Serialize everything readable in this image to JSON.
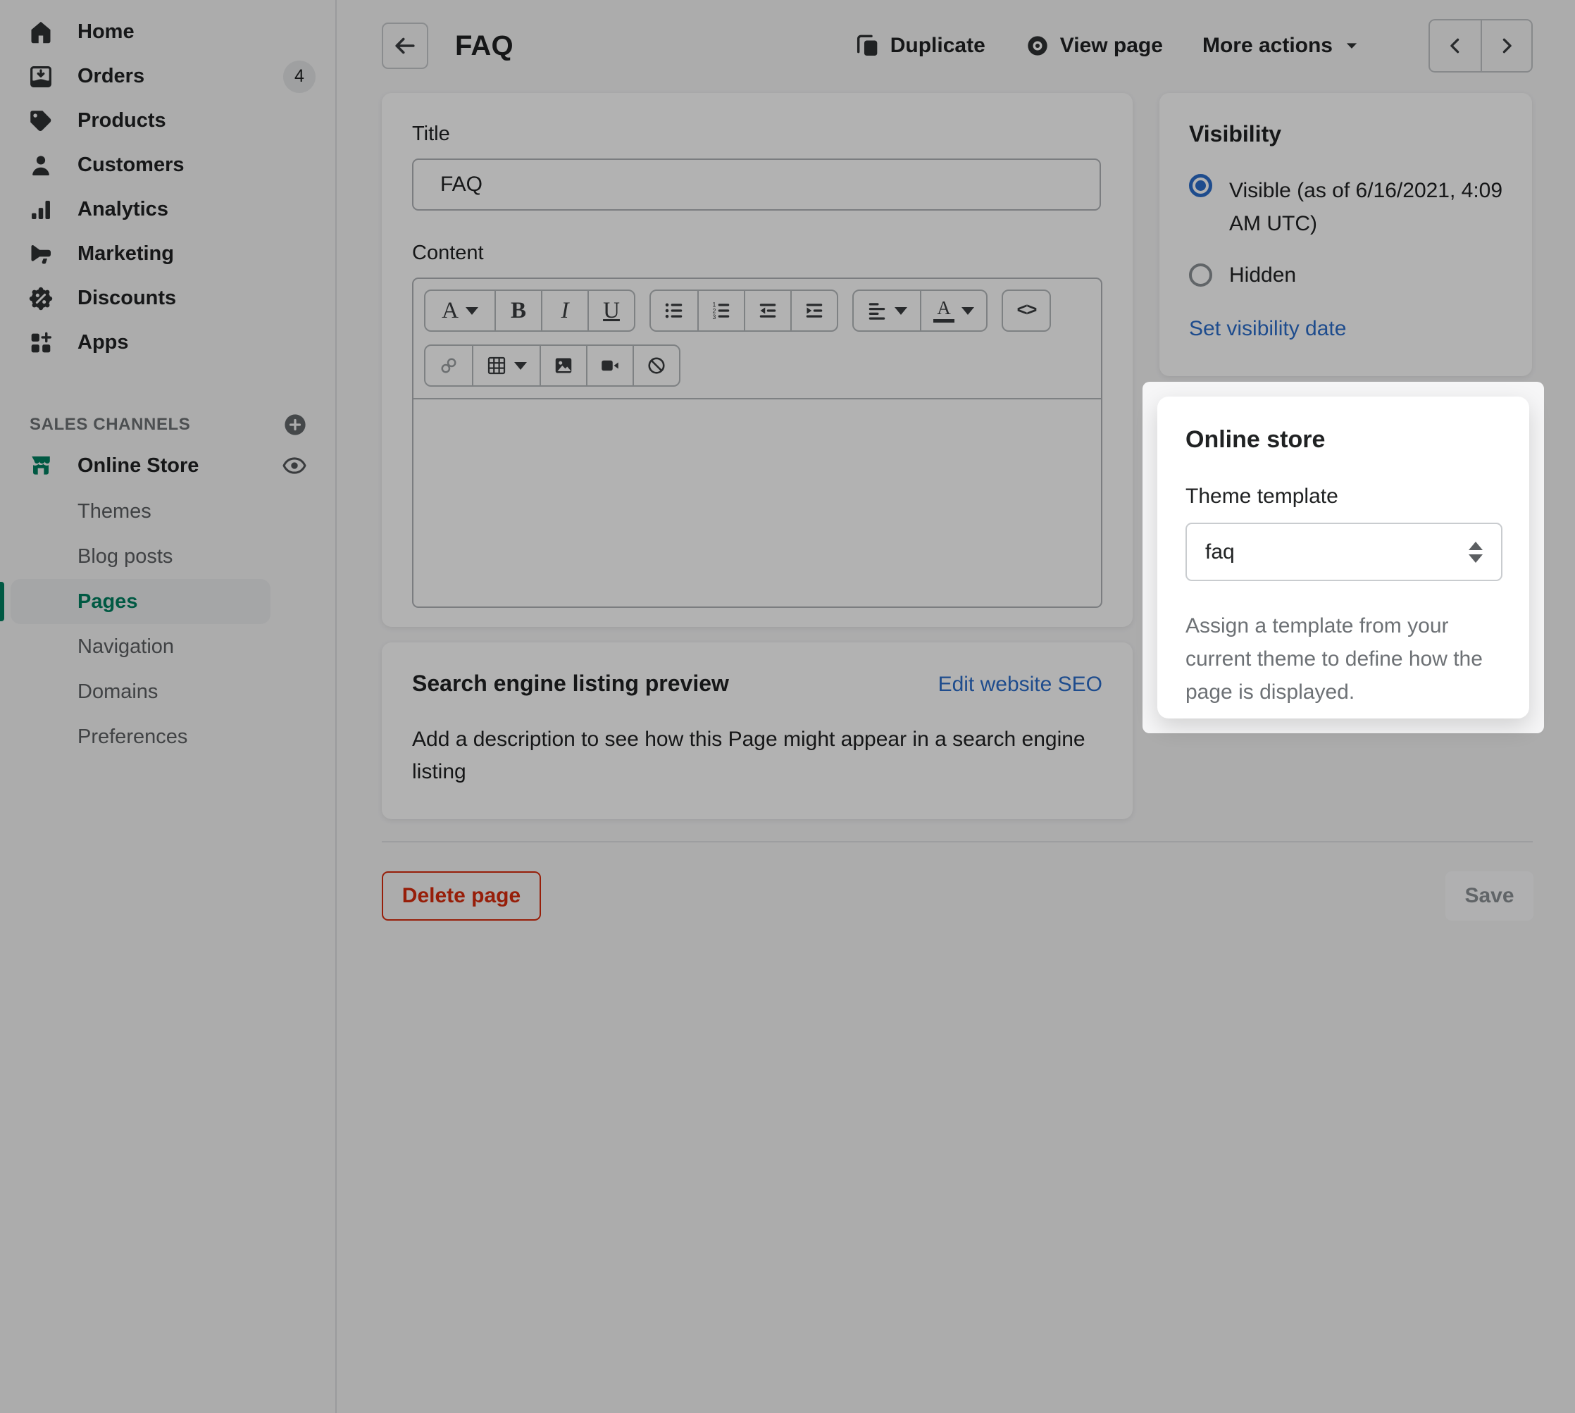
{
  "sidebar": {
    "items": [
      {
        "label": "Home",
        "icon": "home-icon"
      },
      {
        "label": "Orders",
        "icon": "orders-icon",
        "badge": "4"
      },
      {
        "label": "Products",
        "icon": "tag-icon"
      },
      {
        "label": "Customers",
        "icon": "person-icon"
      },
      {
        "label": "Analytics",
        "icon": "bar-chart-icon"
      },
      {
        "label": "Marketing",
        "icon": "megaphone-icon"
      },
      {
        "label": "Discounts",
        "icon": "discount-badge-icon"
      },
      {
        "label": "Apps",
        "icon": "apps-grid-icon"
      }
    ],
    "sales_channels": {
      "heading": "SALES CHANNELS",
      "add_icon": "plus-circle-icon",
      "store_label": "Online Store",
      "store_icon": "storefront-icon",
      "preview_icon": "eye-icon",
      "subitems": [
        {
          "label": "Themes"
        },
        {
          "label": "Blog posts"
        },
        {
          "label": "Pages",
          "active": true
        },
        {
          "label": "Navigation"
        },
        {
          "label": "Domains"
        },
        {
          "label": "Preferences"
        }
      ]
    }
  },
  "header": {
    "title": "FAQ",
    "duplicate_label": "Duplicate",
    "view_page_label": "View page",
    "more_actions_label": "More actions"
  },
  "title_card": {
    "title_label": "Title",
    "title_value": "FAQ",
    "content_label": "Content"
  },
  "toolbar": {
    "font_glyph": "A",
    "bold_glyph": "B",
    "italic_glyph": "I",
    "underline_glyph": "U",
    "color_glyph": "A",
    "code_glyph": "<>",
    "ordered_digits": [
      "1",
      "2",
      "3"
    ],
    "icons": [
      "formatting-icon",
      "bold-icon",
      "italic-icon",
      "underline-icon",
      "bulleted-list-icon",
      "numbered-list-icon",
      "outdent-icon",
      "indent-icon",
      "alignment-icon",
      "text-color-icon",
      "code-icon",
      "link-icon",
      "table-icon",
      "image-icon",
      "video-icon",
      "clear-formatting-icon"
    ]
  },
  "seo_card": {
    "title": "Search engine listing preview",
    "action_label": "Edit website SEO",
    "body": "Add a description to see how this Page might appear in a search engine listing"
  },
  "visibility_card": {
    "title": "Visibility",
    "options": [
      {
        "label": "Visible (as of 6/16/2021, 4:09 AM UTC)",
        "selected": true
      },
      {
        "label": "Hidden",
        "selected": false
      }
    ],
    "link_label": "Set visibility date"
  },
  "online_store_card": {
    "title": "Online store",
    "template_label": "Theme template",
    "template_value": "faq",
    "description": "Assign a template from your current theme to define how the page is displayed."
  },
  "footer": {
    "delete_label": "Delete page",
    "save_label": "Save"
  },
  "colors": {
    "accent_green": "#008060",
    "link_blue": "#2c6ecb",
    "radio_blue": "#2c6ecb",
    "destructive_red": "#d82c0d",
    "badge_bg": "#e4e5e7",
    "page_bg": "#f6f6f7",
    "dim_overlay": "rgba(0,0,0,0.30)"
  }
}
